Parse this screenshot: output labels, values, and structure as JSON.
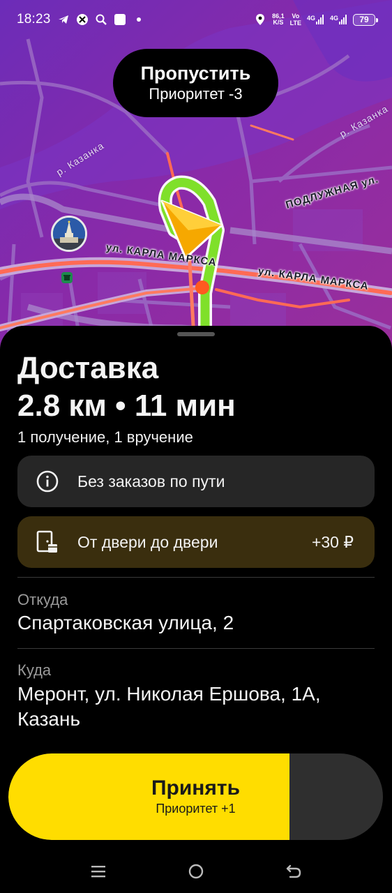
{
  "status_bar": {
    "time": "18:23",
    "speed_value": "86,1",
    "speed_unit": "K/S",
    "net_top": "Vo",
    "net_bottom": "LTE",
    "signal1": "4G",
    "signal2": "4G",
    "battery": "79"
  },
  "map": {
    "skip_title": "Пропустить",
    "skip_sub": "Приоритет -3",
    "street_main": "ул. КАРЛА МАРКСА",
    "street_main_2": "ул. КАРЛА МАРКСА",
    "street_side": "ПОДЛУЖНАЯ ул.",
    "river_1": "р. Казанка",
    "river_2": "р. Казанка"
  },
  "order": {
    "title": "Доставка",
    "metrics": "2.8 км • 11 мин",
    "steps": "1 получение, 1 вручение",
    "no_orders": "Без заказов по пути",
    "door_to_door": "От двери до двери",
    "door_price": "+30 ₽",
    "from_label": "Откуда",
    "from_value": "Спартаковская улица, 2",
    "to_label": "Куда",
    "to_value": "Меронт, ул. Николая Ершова, 1А, Казань"
  },
  "action": {
    "accept_title": "Принять",
    "accept_sub": "Приоритет +1"
  },
  "colors": {
    "map_bg": "#7a2bb0",
    "accept": "#ffdd00",
    "route": "#7fe02a",
    "traffic": "#ff5a4a"
  }
}
